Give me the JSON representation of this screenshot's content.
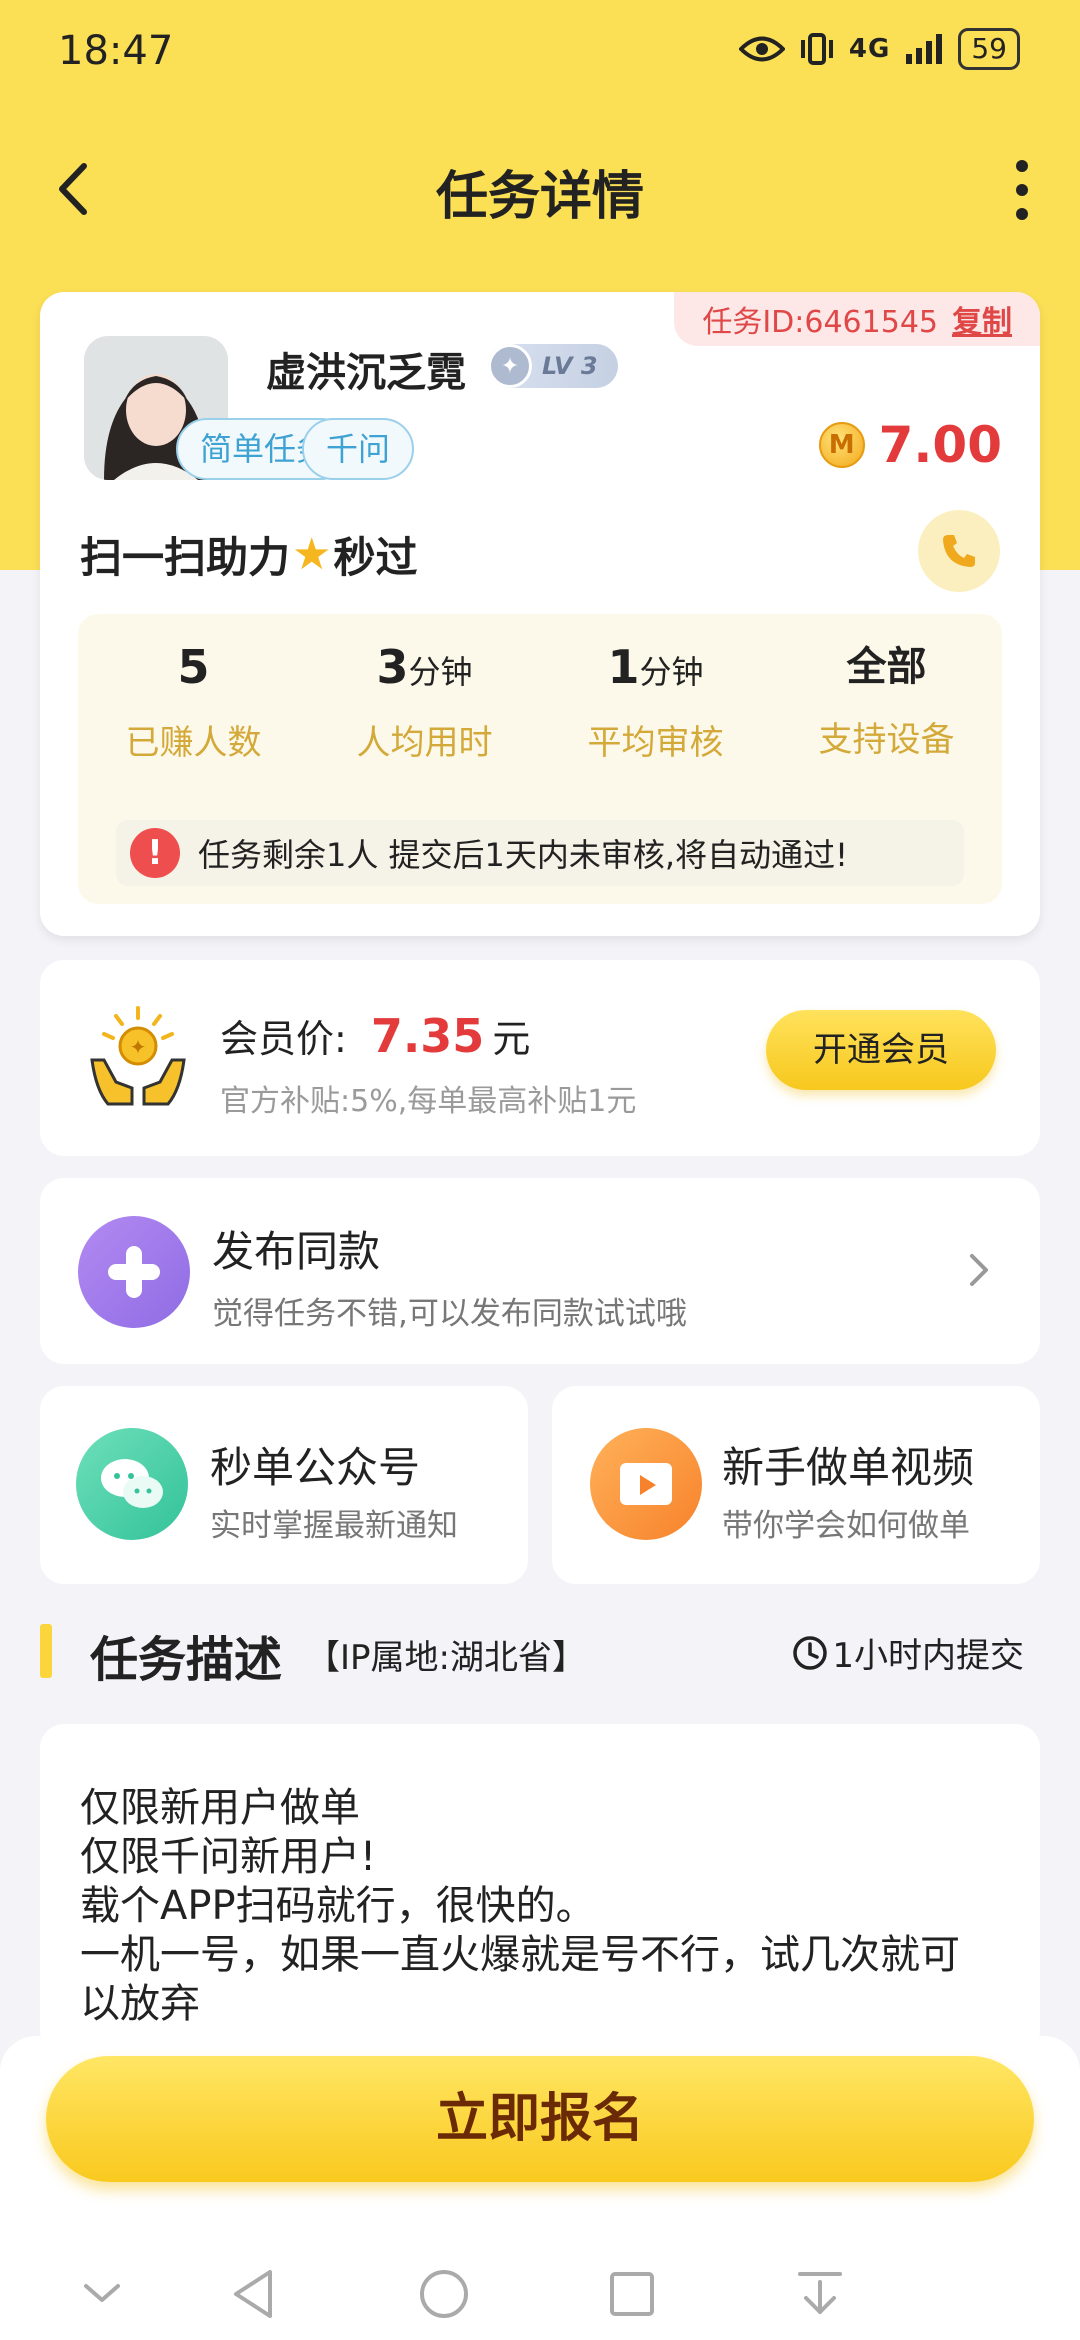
{
  "status_bar": {
    "time": "18:47",
    "network": "4G",
    "battery": "59"
  },
  "header": {
    "title": "任务详情",
    "back_icon": "chevron-left-icon",
    "more_icon": "more-vertical-icon"
  },
  "task": {
    "id_label": "任务ID:6461545",
    "copy_label": "复制",
    "user": {
      "name": "虚洪沉乏霓",
      "level": "LV 3"
    },
    "tags": [
      "简单任务",
      "千问"
    ],
    "reward": {
      "coin_letter": "M",
      "amount": "7.00"
    },
    "title_part1": "扫一扫助力",
    "title_part2": "秒过",
    "star_icon": "★",
    "stats": [
      {
        "value": "5",
        "unit": "",
        "label": "已赚人数"
      },
      {
        "value": "3",
        "unit": "分钟",
        "label": "人均用时"
      },
      {
        "value": "1",
        "unit": "分钟",
        "label": "平均审核"
      },
      {
        "value": "全部",
        "unit": "",
        "label": "支持设备"
      }
    ],
    "notice": "任务剩余1人  提交后1天内未审核,将自动通过!"
  },
  "member": {
    "label": "会员价:",
    "price": "7.35",
    "unit": "元",
    "subtitle": "官方补贴:5%,每单最高补贴1元",
    "button": "开通会员"
  },
  "publish": {
    "title": "发布同款",
    "subtitle": "觉得任务不错,可以发布同款试试哦"
  },
  "official_account": {
    "title": "秒单公众号",
    "subtitle": "实时掌握最新通知"
  },
  "tutorial": {
    "title": "新手做单视频",
    "subtitle": "带你学会如何做单"
  },
  "description": {
    "title": "任务描述",
    "ip": "【IP属地:湖北省】",
    "deadline": "1小时内提交",
    "lines": [
      "仅限新用户做单",
      "仅限千问新用户!",
      "载个APP扫码就行，很快的。",
      "一机一号，如果一直火爆就是号不行，试几次就可",
      "以放弃"
    ]
  },
  "bottom": {
    "signup_button": "立即报名"
  },
  "colors": {
    "brand_yellow": "#fbdf55",
    "price_red": "#e33b3b",
    "label_gold": "#d3a93a"
  }
}
